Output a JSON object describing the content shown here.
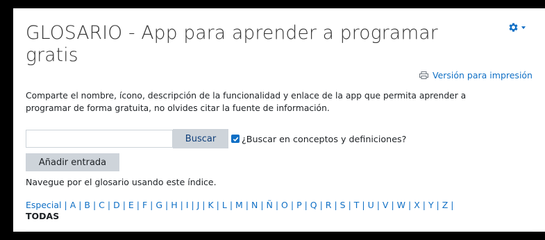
{
  "glossary": {
    "title": "GLOSARIO - App para aprender a programar gratis",
    "print_label": "Versión para impresión",
    "description": "Comparte el nombre, ícono, descripción de la funcionalidad  y  enlace de la app que permita aprender a programar de forma gratuita, no olvides citar la fuente de información.",
    "search": {
      "value": "",
      "placeholder": "",
      "button_label": "Buscar"
    },
    "checkbox_label": "¿Buscar en conceptos y definiciones?",
    "checkbox_checked": true,
    "add_entry_label": "Añadir entrada",
    "browse_text": "Navegue por el glosario usando este índice.",
    "index_first": "Especial",
    "index_letters": [
      "A",
      "B",
      "C",
      "D",
      "E",
      "F",
      "G",
      "H",
      "I",
      "J",
      "K",
      "L",
      "M",
      "N",
      "Ñ",
      "O",
      "P",
      "Q",
      "R",
      "S",
      "T",
      "U",
      "V",
      "W",
      "X",
      "Y",
      "Z"
    ],
    "index_all": "TODAS"
  },
  "icons": {
    "settings": "gear-icon",
    "print": "printer-icon",
    "dropdown": "caret-down-icon"
  },
  "colors": {
    "link": "#0f6fc5",
    "button_bg": "#ced4da",
    "text": "#1d2125"
  }
}
